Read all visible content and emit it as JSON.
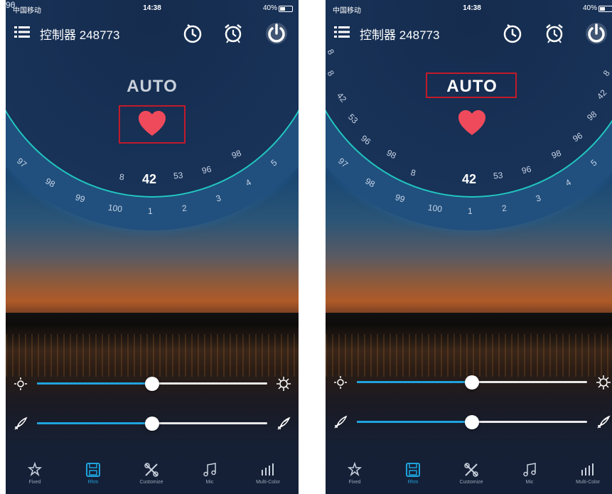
{
  "status_bar": {
    "carrier": "中国移动",
    "time": "14:38",
    "battery": "40%"
  },
  "header": {
    "title": "控制器 248773"
  },
  "mode": {
    "label": "AUTO"
  },
  "dial_numbers": {
    "left": [
      "97",
      "98",
      "99",
      "100",
      "1",
      "2",
      "3",
      "4",
      "5",
      "96",
      "53",
      "8",
      "98",
      "96",
      "90"
    ],
    "left_center": "42",
    "right": [
      "8",
      "8",
      "42",
      "53",
      "96",
      "98",
      "97",
      "98",
      "99",
      "100",
      "1",
      "2",
      "3",
      "4",
      "5",
      "96",
      "53",
      "8",
      "98",
      "96",
      "98",
      "42",
      "8"
    ],
    "right_center": "42"
  },
  "sliders": {
    "brightness": {
      "value": 0.5
    },
    "speed": {
      "value": 0.5
    }
  },
  "tabs": [
    {
      "label": "Fixed",
      "icon": "star-pin-icon",
      "active": false
    },
    {
      "label": "Rhm",
      "icon": "save-disk-icon",
      "active": true
    },
    {
      "label": "Customize",
      "icon": "tools-icon",
      "active": false
    },
    {
      "label": "Mic",
      "icon": "music-icon",
      "active": false
    },
    {
      "label": "Multi-Color",
      "icon": "bars-icon",
      "active": false
    }
  ],
  "colors": {
    "accent": "#1fa3dd",
    "heart": "#ef4a5c",
    "highlight_box": "#c21a2a",
    "dial_rim": "#22c7c1"
  }
}
